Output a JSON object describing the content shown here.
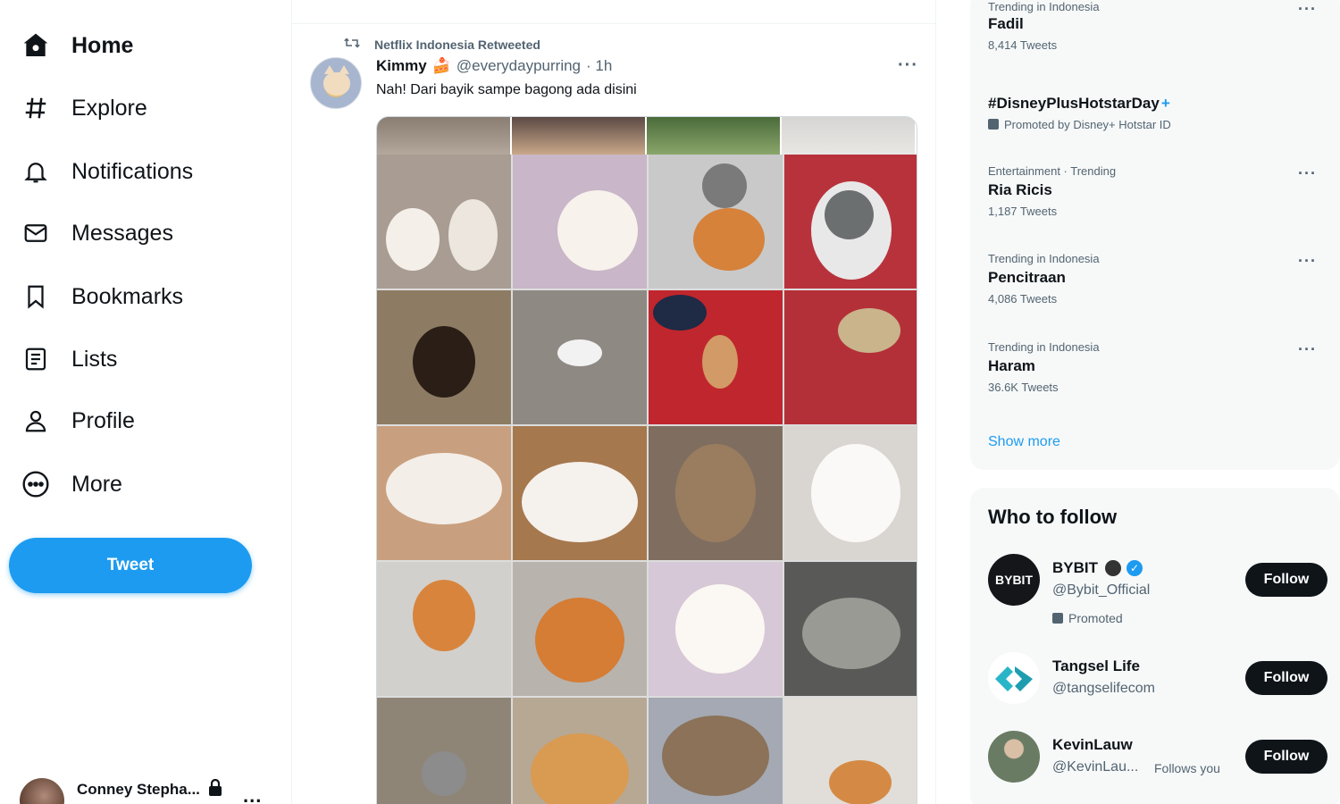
{
  "nav": {
    "items": [
      {
        "label": "Home",
        "icon": "home-icon"
      },
      {
        "label": "Explore",
        "icon": "hashtag-icon"
      },
      {
        "label": "Notifications",
        "icon": "bell-icon"
      },
      {
        "label": "Messages",
        "icon": "envelope-icon"
      },
      {
        "label": "Bookmarks",
        "icon": "bookmark-icon"
      },
      {
        "label": "Lists",
        "icon": "list-icon"
      },
      {
        "label": "Profile",
        "icon": "person-icon"
      },
      {
        "label": "More",
        "icon": "more-circle-icon"
      }
    ],
    "tweet_button": "Tweet",
    "account_name": "Conney Stepha...",
    "account_more": "..."
  },
  "tweet": {
    "retweeted_by": "Netflix Indonesia Retweeted",
    "author_name": "Kimmy",
    "author_emoji": "🍰",
    "author_handle": "@everydaypurring",
    "time": "· 1h",
    "more": "···",
    "text": "Nah! Dari bayik sampe bagong ada disini"
  },
  "trends": [
    {
      "context": "Trending in Indonesia",
      "title": "Fadil",
      "count": "8,414 Tweets"
    },
    {
      "context": "",
      "title": "#DisneyPlusHotstarDay",
      "promoted": "Promoted by Disney+ Hotstar ID"
    },
    {
      "context": "Entertainment · Trending",
      "title": "Ria Ricis",
      "count": "1,187 Tweets"
    },
    {
      "context": "Trending in Indonesia",
      "title": "Pencitraan",
      "count": "4,086 Tweets"
    },
    {
      "context": "Trending in Indonesia",
      "title": "Haram",
      "count": "36.6K Tweets"
    }
  ],
  "trends_more_glyph": "···",
  "trends_plus": "+",
  "show_more": "Show more",
  "who_to_follow": {
    "title": "Who to follow",
    "users": [
      {
        "name": "BYBIT",
        "handle": "@Bybit_Official",
        "sub": "Promoted",
        "button": "Follow",
        "avatar_text": "BYBIT"
      },
      {
        "name": "Tangsel Life",
        "handle": "@tangselifecom",
        "button": "Follow"
      },
      {
        "name": "KevinLauw",
        "handle": "@KevinLau...",
        "follows_you": "Follows you",
        "button": "Follow"
      }
    ]
  },
  "colors": {
    "accent": "#1d9bf0",
    "text": "#0f1419",
    "muted": "#536471",
    "panel": "#f7f9f9"
  }
}
